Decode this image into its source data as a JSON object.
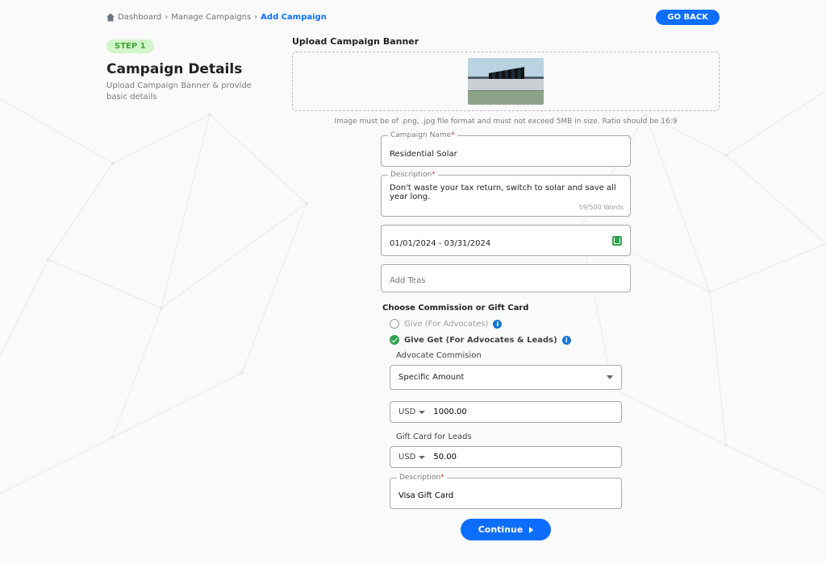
{
  "breadcrumb": {
    "home": "Dashboard",
    "mid": "Manage Campaigns",
    "current": "Add Campaign"
  },
  "go_back": "GO BACK",
  "step": "STEP 1",
  "title": "Campaign Details",
  "subtitle": "Upload Campaign Banner & provide basic details",
  "banner": {
    "heading": "Upload Campaign Banner",
    "hint": "Image must be of .png, .jpg file format and must not exceed 5MB in size. Ratio should be 16:9"
  },
  "fields": {
    "name_label": "Campaign Name",
    "name_value": "Residential Solar",
    "desc_label": "Description",
    "desc_value": "Don't waste your tax return, switch to solar and save all year long.",
    "word_count": "59/500 Words",
    "date_value": "01/01/2024 - 03/31/2024",
    "tags_placeholder": "Add Teas"
  },
  "commission": {
    "heading": "Choose Commission or Gift Card",
    "opt1": "Give (For Advocates)",
    "opt2": "Give Get (For Advocates & Leads)",
    "advocate_label": "Advocate Commision",
    "amount_type": "Specific Amount",
    "currency": "USD",
    "amount1": "1000.00",
    "gift_label": "Gift Card for Leads",
    "amount2": "50.00",
    "desc2_label": "Description",
    "desc2_value": "Visa Gift Card"
  },
  "continue": "Continue"
}
